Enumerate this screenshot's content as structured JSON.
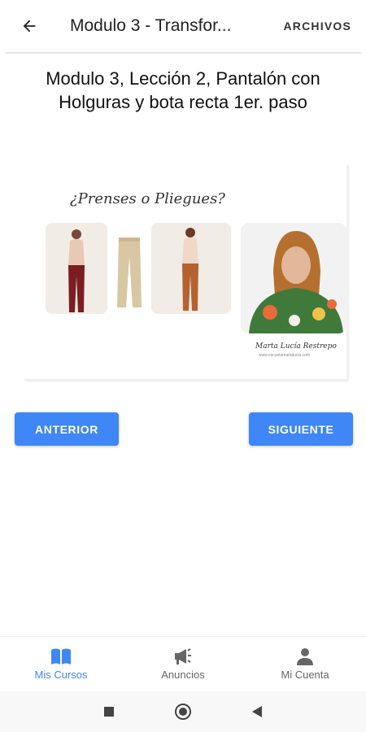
{
  "appbar": {
    "title": "Modulo 3 - Transfor...",
    "action_label": "ARCHIVOS"
  },
  "lesson": {
    "title": "Modulo 3, Lección 2, Pantalón con Holguras y bota recta 1er. paso"
  },
  "media": {
    "caption": "¿Prenses o Pliegues?",
    "signature": "Marta Lucía Restrepo",
    "signature_sub": "www.escuelamartalucia.com"
  },
  "buttons": {
    "previous": "ANTERIOR",
    "next": "SIGUIENTE"
  },
  "bottom_nav": {
    "items": [
      {
        "label": "Mis Cursos",
        "icon": "book-icon",
        "active": true
      },
      {
        "label": "Anuncios",
        "icon": "megaphone-icon",
        "active": false
      },
      {
        "label": "Mi Cuenta",
        "icon": "person-icon",
        "active": false
      }
    ]
  },
  "colors": {
    "accent": "#3f86f6",
    "inactive": "#666666"
  }
}
